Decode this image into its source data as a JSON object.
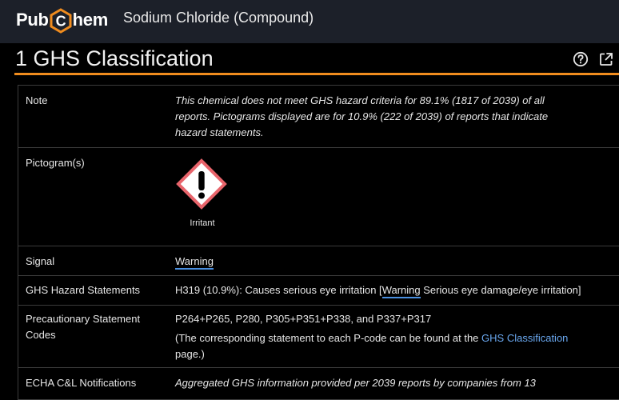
{
  "header": {
    "logo_left": "Pub",
    "logo_hex_letter": "C",
    "logo_right": "hem",
    "title": "Sodium Chloride (Compound)"
  },
  "section": {
    "title": "1 GHS Classification",
    "help_icon": "help-circle-icon",
    "external_icon": "external-link-icon"
  },
  "rows": {
    "note": {
      "label": "Note",
      "line1": "This chemical does not meet GHS hazard criteria for 89.1% (1817 of 2039) of all",
      "line2": "reports. Pictograms displayed are for 10.9% (222 of 2039) of reports that indicate",
      "line3": "hazard statements."
    },
    "pictogram": {
      "label": "Pictogram(s)",
      "caption": "Irritant"
    },
    "signal": {
      "label": "Signal",
      "value": "Warning"
    },
    "hazard": {
      "label": "GHS Hazard Statements",
      "prefix": "H319 (10.9%): Causes serious eye irritation [",
      "warning": "Warning",
      "suffix": " Serious eye damage/eye irritation]"
    },
    "precautionary": {
      "label_line1": "Precautionary Statement",
      "label_line2": "Codes",
      "codes": "P264+P265, P280, P305+P351+P338, and P337+P317",
      "note_prefix": "(The corresponding statement to each P-code can be found at the ",
      "note_link": "GHS Classification",
      "note_suffix": "page.)"
    },
    "echa": {
      "label": "ECHA C&L Notifications",
      "value": "Aggregated GHS information provided per 2039 reports by companies from 13"
    }
  },
  "colors": {
    "accent_orange": "#f08c1e",
    "hazard_red": "#e8646b",
    "link_blue": "#6aa8f0"
  }
}
